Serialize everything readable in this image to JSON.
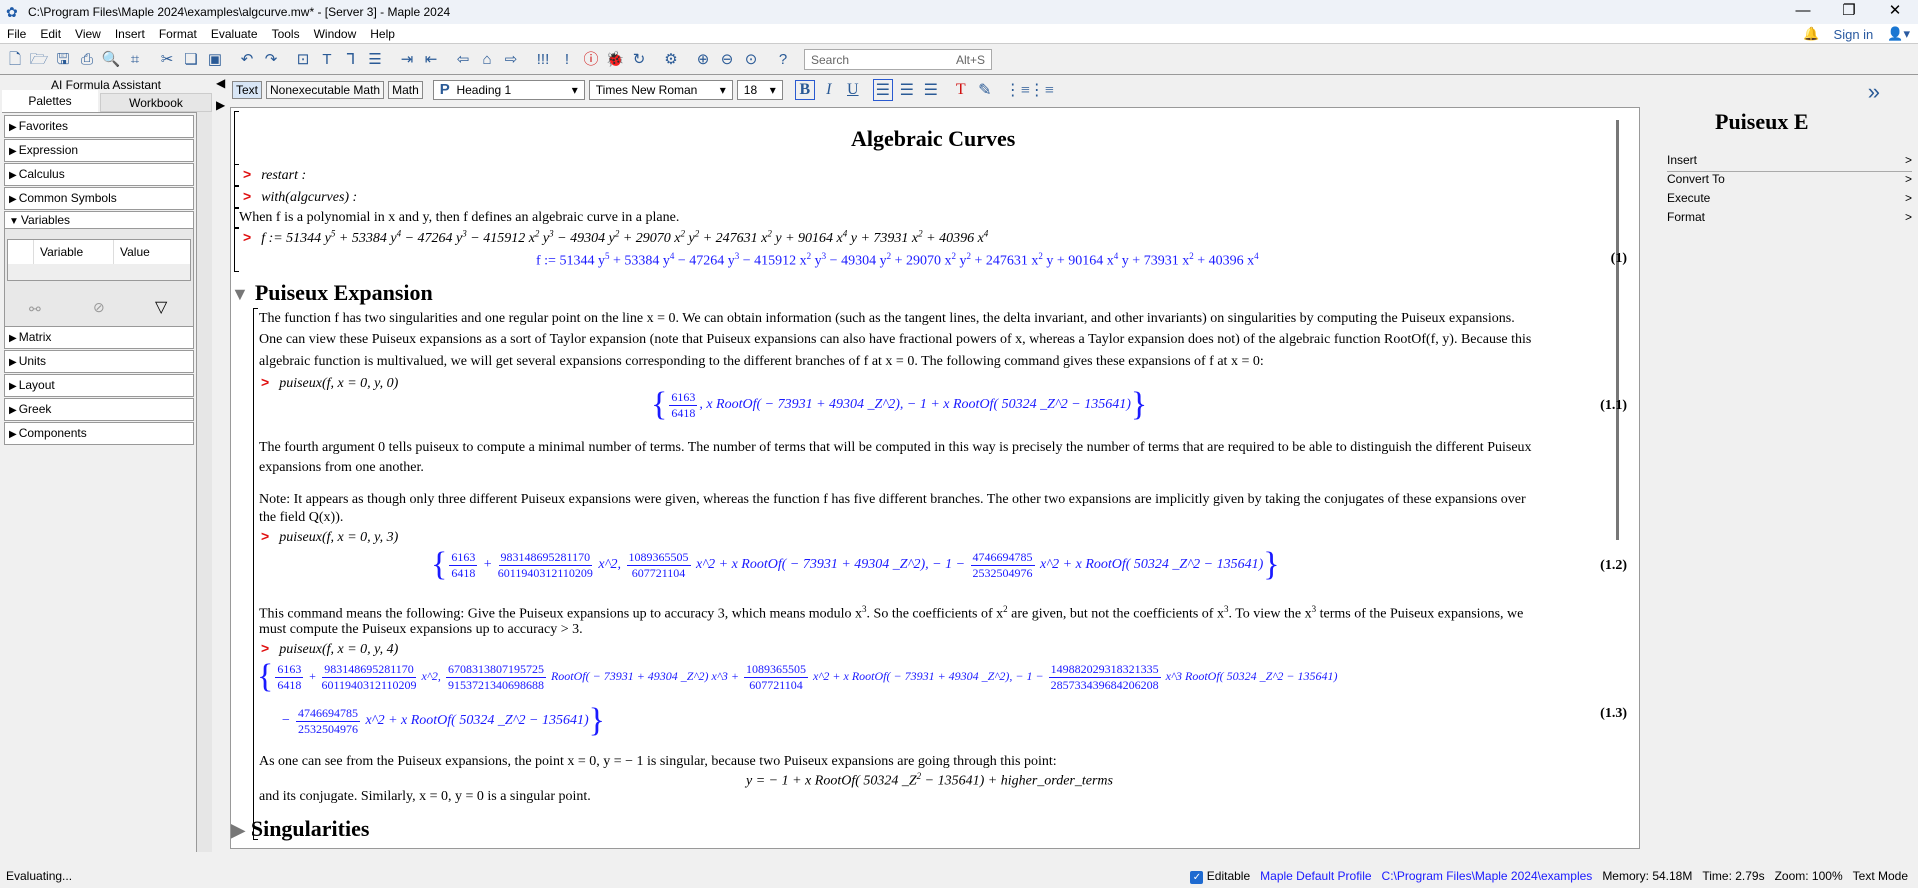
{
  "window": {
    "title": "C:\\Program Files\\Maple 2024\\examples\\algcurve.mw* - [Server 3] - Maple 2024",
    "minimize": "—",
    "restore": "❐",
    "close": "✕"
  },
  "menu": [
    "File",
    "Edit",
    "View",
    "Insert",
    "Format",
    "Evaluate",
    "Tools",
    "Window",
    "Help"
  ],
  "account": {
    "sign_in": "Sign in"
  },
  "toolbar_icons": [
    {
      "name": "new-icon",
      "g": "🗋"
    },
    {
      "name": "open-icon",
      "g": "🗁"
    },
    {
      "name": "save-icon",
      "g": "🖫"
    },
    {
      "name": "print-icon",
      "g": "⎙"
    },
    {
      "name": "print-preview-icon",
      "g": "🔍"
    },
    {
      "name": "crop-icon",
      "g": "⌗",
      "sep": true
    },
    {
      "name": "cut-icon",
      "g": "✂"
    },
    {
      "name": "copy-icon",
      "g": "❏"
    },
    {
      "name": "paste-icon",
      "g": "▣",
      "sep": true
    },
    {
      "name": "undo-icon",
      "g": "↶"
    },
    {
      "name": "redo-icon",
      "g": "↷",
      "sep": true
    },
    {
      "name": "insert-math-icon",
      "g": "⊡"
    },
    {
      "name": "text-mode-icon",
      "g": "T"
    },
    {
      "name": "execution-group-icon",
      "g": "⅂"
    },
    {
      "name": "paragraph-icon",
      "g": "☰",
      "sep": true
    },
    {
      "name": "indent-icon",
      "g": "⇥"
    },
    {
      "name": "outdent-icon",
      "g": "⇤",
      "sep": true
    },
    {
      "name": "back-icon",
      "g": "⇦"
    },
    {
      "name": "home-icon",
      "g": "⌂"
    },
    {
      "name": "forward-icon",
      "g": "⇨",
      "sep": true
    },
    {
      "name": "execute-all-icon",
      "g": "!!!"
    },
    {
      "name": "execute-icon",
      "g": "!"
    },
    {
      "name": "stop-icon",
      "g": "ⓘ",
      "red": true
    },
    {
      "name": "debug-icon",
      "g": "🐞"
    },
    {
      "name": "restart-icon",
      "g": "↻",
      "sep": true
    },
    {
      "name": "settings-icon",
      "g": "⚙",
      "sep": true
    },
    {
      "name": "zoom-in-icon",
      "g": "⊕"
    },
    {
      "name": "zoom-out-icon",
      "g": "⊖"
    },
    {
      "name": "zoom-reset-icon",
      "g": "⊙",
      "sep": true
    },
    {
      "name": "help-icon",
      "g": "?"
    }
  ],
  "search": {
    "placeholder": "Search",
    "shortcut": "Alt+S"
  },
  "left_panel": {
    "ai_tab": "AI Formula Assistant",
    "tabs": [
      "Palettes",
      "Workbook"
    ],
    "palettes_top": [
      "Favorites",
      "Expression",
      "Calculus",
      "Common Symbols"
    ],
    "variables": {
      "label": "Variables",
      "col_variable": "Variable",
      "col_value": "Value"
    },
    "palettes_bottom": [
      "Matrix",
      "Units",
      "Layout",
      "Greek",
      "Components"
    ]
  },
  "format_bar": {
    "text": "Text",
    "nonexec": "Nonexecutable Math",
    "math": "Math",
    "style": "Heading 1",
    "font": "Times New Roman",
    "size": "18",
    "bold": "B",
    "italic": "I",
    "underline": "U"
  },
  "document": {
    "title": "Algebraic Curves",
    "prompt": ">",
    "restart": "restart :",
    "with": "with(algcurves) :",
    "intro": "When f is a polynomial in x and y, then f defines an algebraic curve in a plane.",
    "f_input": "f := 51344 y^5 + 53384 y^4 − 47264 y^3 − 415912 x^2 y^3 − 49304 y^2 + 29070 x^2 y^2 + 247631 x^2 y + 90164 x^4 y + 73931 x^2 + 40396 x^4",
    "f_output": "f := 51344 y^5 + 53384 y^4 − 47264 y^3 − 415912 x^2 y^3 − 49304 y^2 + 29070 x^2 y^2 + 247631 x^2 y + 90164 x^4 y + 73931 x^2 + 40396 x^4",
    "label_1": "(1)",
    "section1": "Puiseux Expansion",
    "para1": [
      "The function f has two singularities and one regular point on the line x = 0. We can obtain information (such as the tangent lines, the delta invariant, and other invariants) on singularities by computing the Puiseux expansions.",
      "One can view these Puiseux expansions as a sort of Taylor expansion (note that Puiseux expansions can also have fractional powers of x, whereas a Taylor expansion does not) of the algebraic function RootOf(f, y). Because this",
      "algebraic function is multivalued, we will get several expansions corresponding to the different branches of f at x = 0. The following command gives these expansions of f at x = 0:"
    ],
    "cmd1": "puiseux(f, x = 0, y, 0)",
    "out1": [
      {
        "t": "{"
      },
      {
        "n": "6163",
        "d": "6418"
      },
      {
        "t": ", x RootOf( − 73931 + 49304 _Z^2), − 1 + x RootOf( 50324 _Z^2 − 135641)"
      },
      {
        "t": "}"
      }
    ],
    "label_1_1": "(1.1)",
    "para2": [
      "The fourth argument 0 tells puiseux to compute a minimal number of terms. The number of terms that will be computed in this way is precisely the number of terms that are required to be able to distinguish the different Puiseux",
      "expansions from one another."
    ],
    "para3": [
      "Note: It appears as though only three different Puiseux expansions were given, whereas the function f has five different branches. The other two expansions are implicitly given by taking the conjugates of these expansions over",
      "the field Q(x))."
    ],
    "cmd2": "puiseux(f, x = 0, y, 3)",
    "out2": [
      {
        "t": "{"
      },
      {
        "n": "6163",
        "d": "6418"
      },
      {
        "t": " + "
      },
      {
        "n": "983148695281170",
        "d": "6011940312110209"
      },
      {
        "t": " x^2, "
      },
      {
        "n": "1089365505",
        "d": "607721104"
      },
      {
        "t": " x^2 + x RootOf( − 73931 + 49304 _Z^2), − 1 − "
      },
      {
        "n": "4746694785",
        "d": "2532504976"
      },
      {
        "t": " x^2 + x RootOf( 50324 _Z^2 − 135641)"
      },
      {
        "t": "}"
      }
    ],
    "label_1_2": "(1.2)",
    "para4": [
      "This command means the following: Give the Puiseux expansions up to accuracy 3, which means modulo x^3. So the coefficients of x^2 are given, but not the coefficients of x^3. To view the x^3 terms of the Puiseux expansions, we",
      "must compute the Puiseux expansions up to accuracy > 3."
    ],
    "cmd3": "puiseux(f, x = 0, y, 4)",
    "out3a": [
      {
        "t": "{"
      },
      {
        "n": "6163",
        "d": "6418"
      },
      {
        "t": " + "
      },
      {
        "n": "983148695281170",
        "d": "6011940312110209"
      },
      {
        "t": " x^2, "
      },
      {
        "n": "6708313807195725",
        "d": "9153721340698688"
      },
      {
        "t": " RootOf( − 73931 + 49304 _Z^2) x^3 + "
      },
      {
        "n": "1089365505",
        "d": "607721104"
      },
      {
        "t": " x^2 + x RootOf( − 73931 + 49304 _Z^2), − 1 − "
      },
      {
        "n": "149882029318321335",
        "d": "285733439684206208"
      },
      {
        "t": " x^3 RootOf( 50324 _Z^2 − 135641)"
      }
    ],
    "out3b": [
      {
        "t": "− "
      },
      {
        "n": "4746694785",
        "d": "2532504976"
      },
      {
        "t": " x^2 + x RootOf( 50324 _Z^2 − 135641)"
      },
      {
        "t": "}"
      }
    ],
    "label_1_3": "(1.3)",
    "para5": "As one can see from the Puiseux expansions, the point x = 0, y = − 1 is singular, because two Puiseux expansions are going through this point:",
    "y_expr": "y = − 1 + x RootOf( 50324 _Z^2 − 135641) + higher_order_terms",
    "para6": "and its conjugate. Similarly, x = 0, y = 0 is a singular point.",
    "section2": "Singularities"
  },
  "right_panel": {
    "expand": "»",
    "heading": "Puiseux E",
    "items": [
      "Insert",
      "Convert To",
      "Execute",
      "Format"
    ],
    "chevron": ">"
  },
  "status": {
    "left": "Evaluating...",
    "editable": "Editable",
    "profile": "Maple Default Profile",
    "path": "C:\\Program Files\\Maple 2024\\examples",
    "memory": "Memory: 54.18M",
    "time": "Time: 2.79s",
    "zoom": "Zoom: 100%",
    "mode": "Text Mode"
  }
}
